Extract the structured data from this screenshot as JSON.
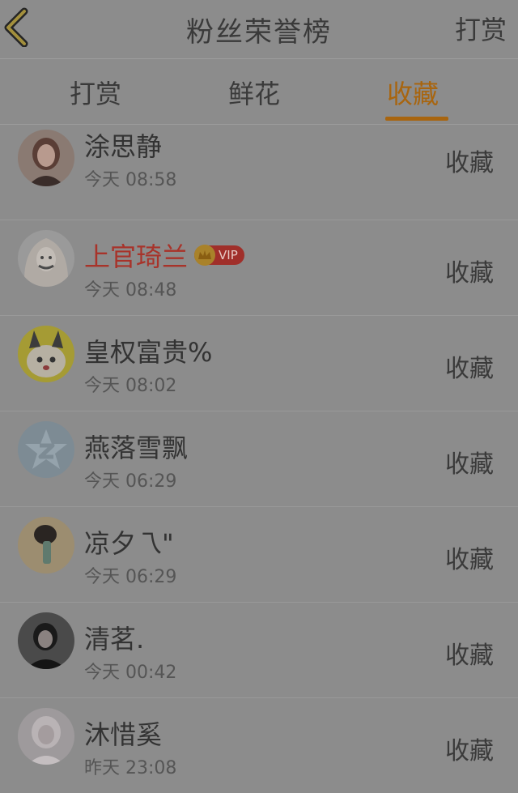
{
  "header": {
    "title": "粉丝荣誉榜",
    "action_label": "打赏"
  },
  "tabs": [
    {
      "label": "打赏"
    },
    {
      "label": "鲜花"
    },
    {
      "label": "收藏"
    }
  ],
  "active_tab_index": 2,
  "accent_color": "#a8650f",
  "rows": [
    {
      "name": "涂思静",
      "time": "今天 08:58",
      "action": "收藏",
      "vip": false
    },
    {
      "name": "上官琦兰",
      "time": "今天 08:48",
      "action": "收藏",
      "vip": true,
      "badge": "VIP"
    },
    {
      "name": "皇权富贵%",
      "time": "今天 08:02",
      "action": "收藏",
      "vip": false
    },
    {
      "name": "燕落雪飘",
      "time": "今天 06:29",
      "action": "收藏",
      "vip": false
    },
    {
      "name": "凉夕乁\"",
      "time": "今天 06:29",
      "action": "收藏",
      "vip": false
    },
    {
      "name": "清茗.",
      "time": "今天 00:42",
      "action": "收藏",
      "vip": false
    },
    {
      "name": "沐惜奚",
      "time": "昨天 23:08",
      "action": "收藏",
      "vip": false
    }
  ]
}
